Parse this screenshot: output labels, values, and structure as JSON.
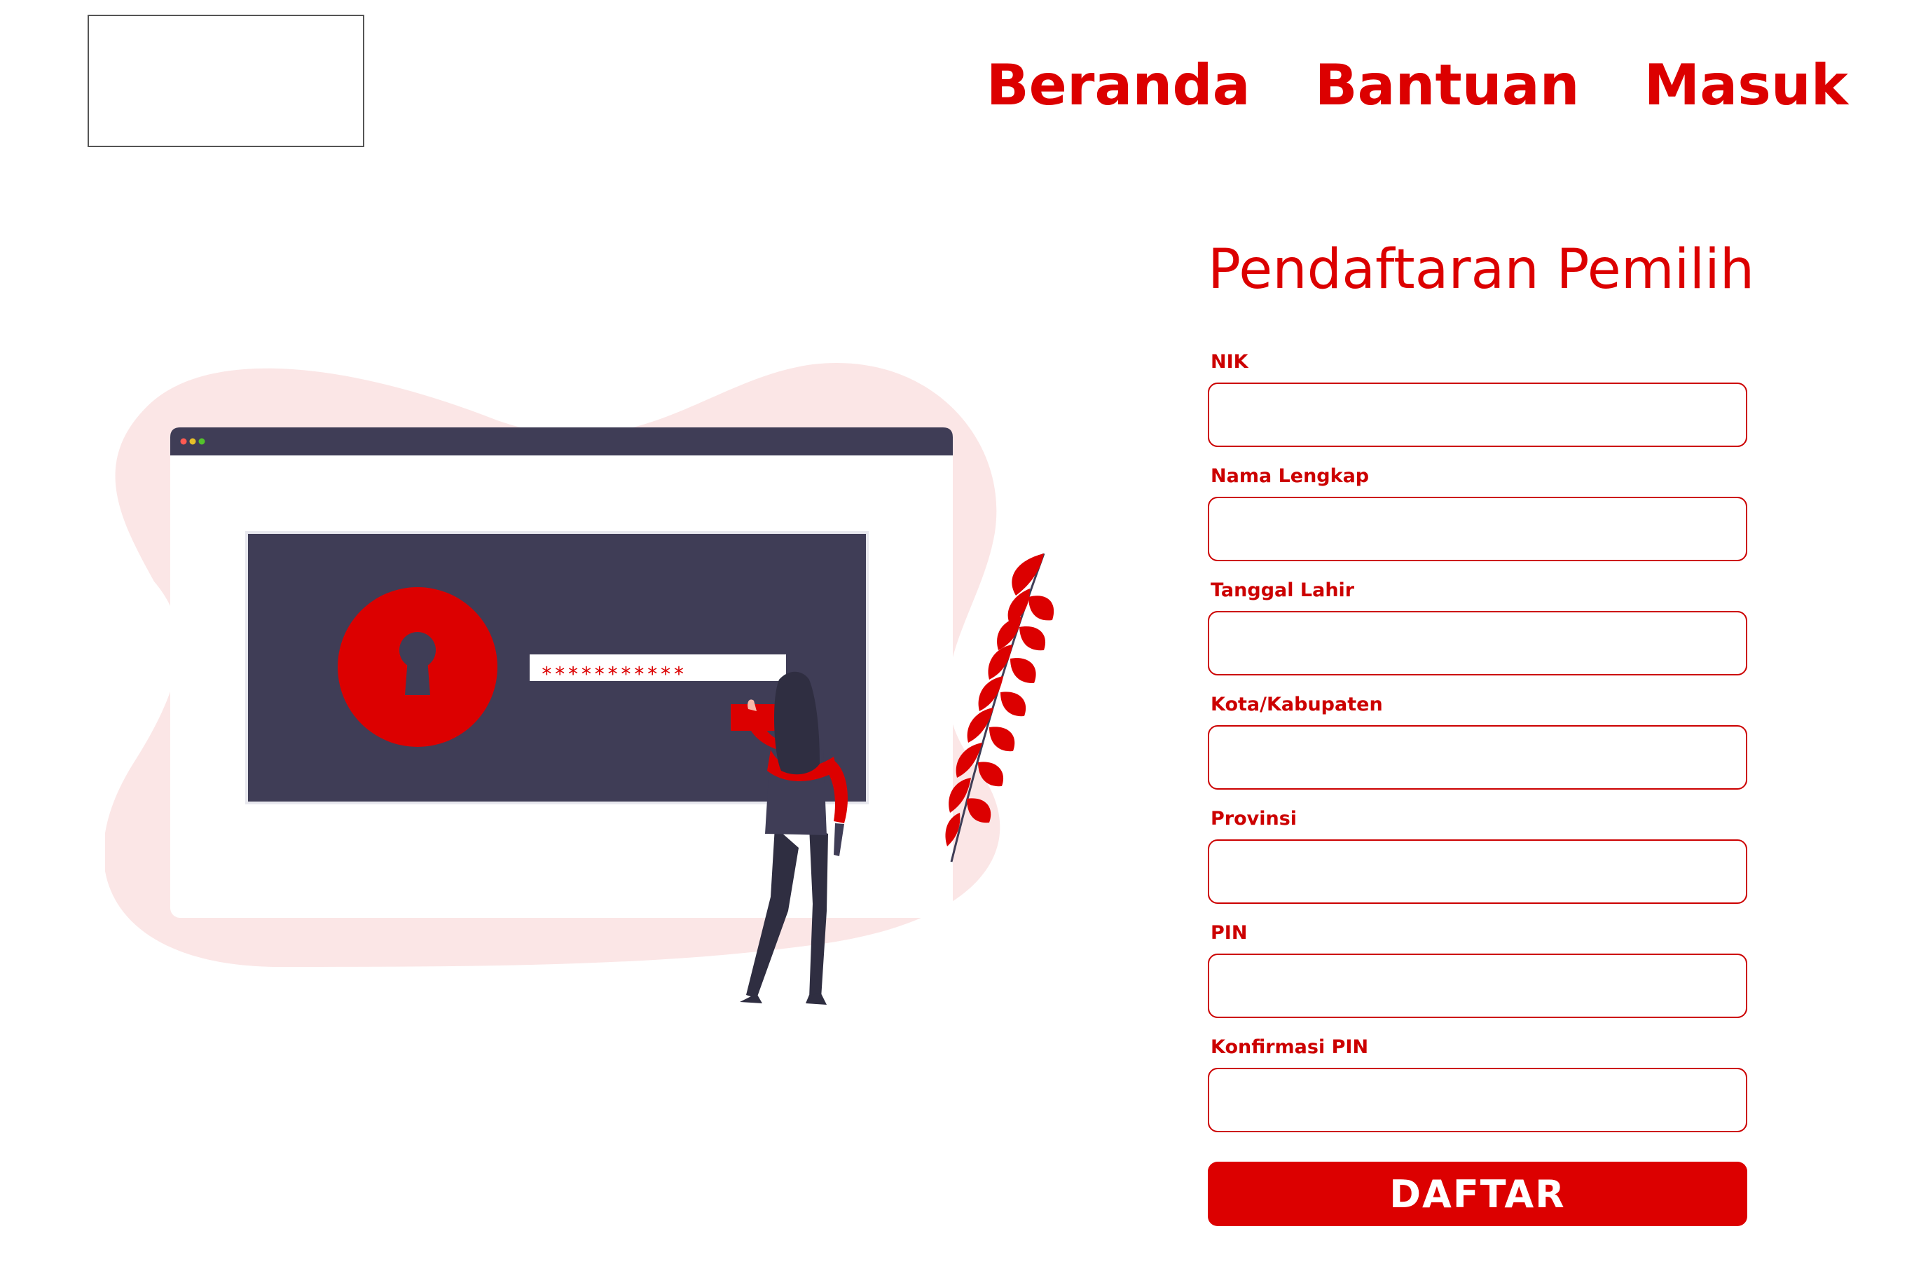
{
  "colors": {
    "accent": "#dc0000",
    "dark": "#3f3d56",
    "blob": "#fbe6e6"
  },
  "logo": {
    "icon": "logo-placeholder"
  },
  "nav": {
    "items": [
      {
        "label": "Beranda"
      },
      {
        "label": "Bantuan"
      },
      {
        "label": "Masuk"
      }
    ]
  },
  "illustration": {
    "password_mask": "∗∗∗∗∗∗∗∗∗∗∗",
    "icons": [
      "lock-icon",
      "browser-window",
      "woman-figure",
      "leaf-plant"
    ]
  },
  "form": {
    "title": "Pendaftaran Pemilih",
    "fields": [
      {
        "label": "NIK",
        "value": "",
        "placeholder": ""
      },
      {
        "label": "Nama Lengkap",
        "value": "",
        "placeholder": ""
      },
      {
        "label": "Tanggal Lahir",
        "value": "",
        "placeholder": ""
      },
      {
        "label": "Kota/Kabupaten",
        "value": "",
        "placeholder": ""
      },
      {
        "label": "Provinsi",
        "value": "",
        "placeholder": ""
      },
      {
        "label": "PIN",
        "value": "",
        "placeholder": ""
      },
      {
        "label": "Konfirmasi PIN",
        "value": "",
        "placeholder": ""
      }
    ],
    "submit_label": "DAFTAR"
  }
}
